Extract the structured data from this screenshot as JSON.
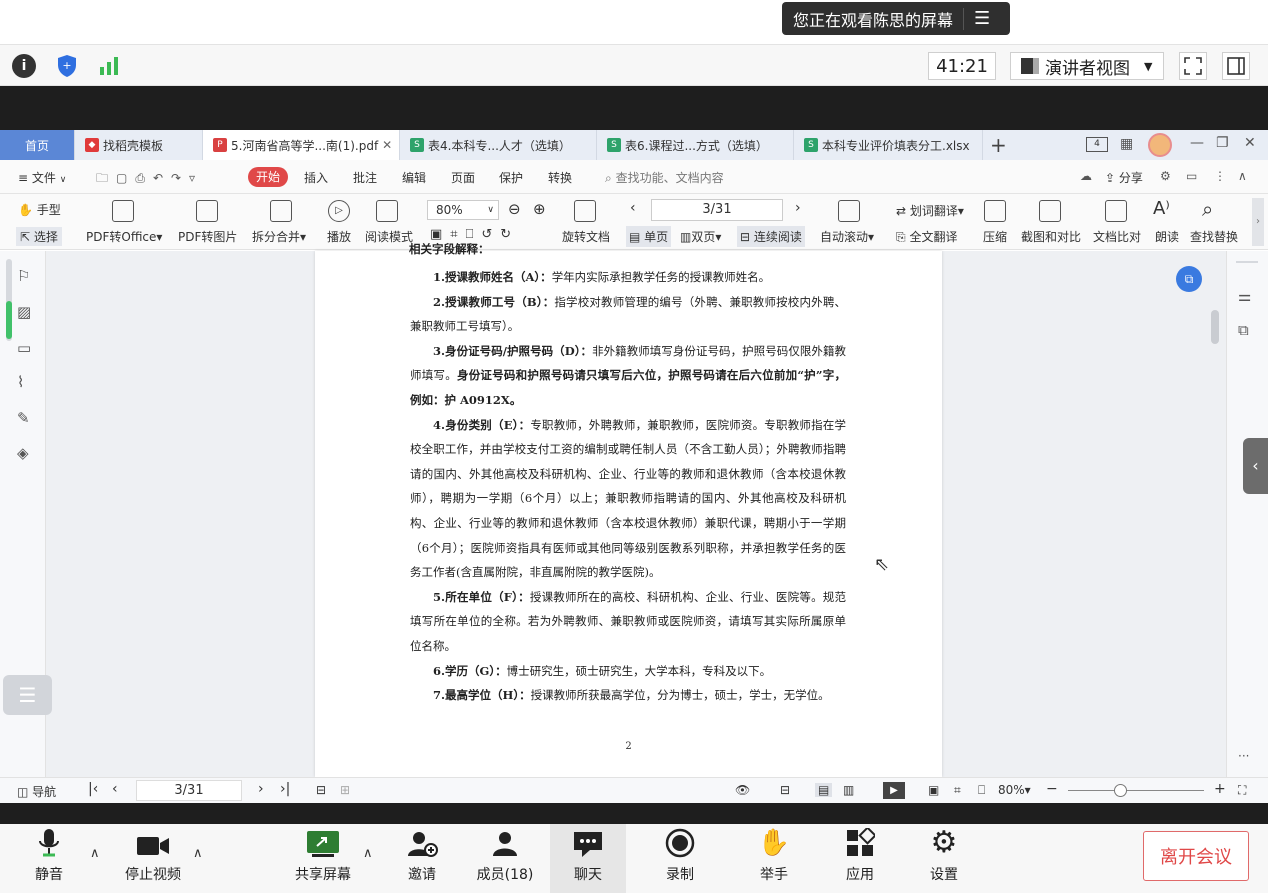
{
  "banner": {
    "sharing_text": "您正在观看陈思的屏幕"
  },
  "meeting_toolbar": {
    "timer": "41:21",
    "presenter_view": "演讲者视图"
  },
  "wps": {
    "tabs": [
      {
        "label": "首页",
        "active": false
      },
      {
        "label": "找稻壳模板",
        "active": false
      },
      {
        "label": "5.河南省高等学...南(1).pdf",
        "active": true
      },
      {
        "label": "表4.本科专...人才（选填）",
        "active": false
      },
      {
        "label": "表6.课程过...方式（选填）",
        "active": false
      },
      {
        "label": "本科专业评价填表分工.xlsx",
        "active": false
      }
    ],
    "menu": {
      "file": "文件",
      "items": [
        "开始",
        "插入",
        "批注",
        "编辑",
        "页面",
        "保护",
        "转换"
      ],
      "search_placeholder": "查找功能、文档内容",
      "share": "分享"
    },
    "ribbon": {
      "hand": "手型",
      "select": "选择",
      "pdf_to_office": "PDF转Office",
      "pdf_to_image": "PDF转图片",
      "split_merge": "拆分合并",
      "play": "播放",
      "read_mode": "阅读模式",
      "zoom": "80%",
      "page_indicator": "3/31",
      "rotate": "旋转文档",
      "single": "单页",
      "double": "双页",
      "continuous": "连续阅读",
      "auto_scroll": "自动滚动",
      "word_translate": "划词翻译",
      "full_translate": "全文翻译",
      "compress": "压缩",
      "screenshot_compare": "截图和对比",
      "doc_compare": "文档比对",
      "read_aloud": "朗读",
      "find_replace": "查找替换"
    },
    "document": {
      "top_fragment": "相关字段解释：",
      "page_number": "2",
      "paragraphs": [
        {
          "bold": "1.授课教师姓名（A）：",
          "text": "学年内实际承担教学任务的授课教师姓名。",
          "bold_tail": ""
        },
        {
          "bold": "2.授课教师工号（B）：",
          "text": "指学校对教师管理的编号（外聘、兼职教师按校内外聘、兼职教师工号填写）。",
          "bold_tail": ""
        },
        {
          "bold": "3.身份证号码/护照号码（D）：",
          "text": "非外籍教师填写身份证号码，护照号码仅限外籍教师填写。",
          "bold_tail": "身份证号码和护照号码请只填写后六位，护照号码请在后六位前加“护”字，例如：护 A0912X。"
        },
        {
          "bold": "4.身份类别（E）：",
          "text": "专职教师，外聘教师，兼职教师，医院师资。专职教师指在学校全职工作，并由学校支付工资的编制或聘任制人员（不含工勤人员）；外聘教师指聘请的国内、外其他高校及科研机构、企业、行业等的教师和退休教师（含本校退休教师），聘期为一学期（6个月）以上；兼职教师指聘请的国内、外其他高校及科研机构、企业、行业等的教师和退休教师（含本校退休教师）兼职代课，聘期小于一学期（6个月）；医院师资指具有医师或其他同等级别医教系列职称，并承担教学任务的医务工作者(含直属附院，非直属附院的教学医院)。",
          "bold_tail": ""
        },
        {
          "bold": "5.所在单位（F）：",
          "text": "授课教师所在的高校、科研机构、企业、行业、医院等。规范填写所在单位的全称。若为外聘教师、兼职教师或医院师资，请填写其实际所属原单位名称。",
          "bold_tail": ""
        },
        {
          "bold": "6.学历（G）：",
          "text": "博士研究生，硕士研究生，大学本科，专科及以下。",
          "bold_tail": ""
        },
        {
          "bold": "7.最高学位（H）：",
          "text": "授课教师所获最高学位，分为博士，硕士，学士，无学位。",
          "bold_tail": ""
        }
      ]
    },
    "status": {
      "nav": "导航",
      "page": "3/31",
      "zoom": "80%"
    }
  },
  "bottom_bar": {
    "mute": "静音",
    "stop_video": "停止视频",
    "share_screen": "共享屏幕",
    "invite": "邀请",
    "members": "成员(18)",
    "chat": "聊天",
    "record": "录制",
    "raise_hand": "举手",
    "apps": "应用",
    "settings": "设置",
    "leave": "离开会议"
  },
  "colors": {
    "accent_red": "#e04848",
    "tab_bar": "#e8edf5",
    "green": "#3cba54",
    "blue": "#2f6fe0"
  }
}
